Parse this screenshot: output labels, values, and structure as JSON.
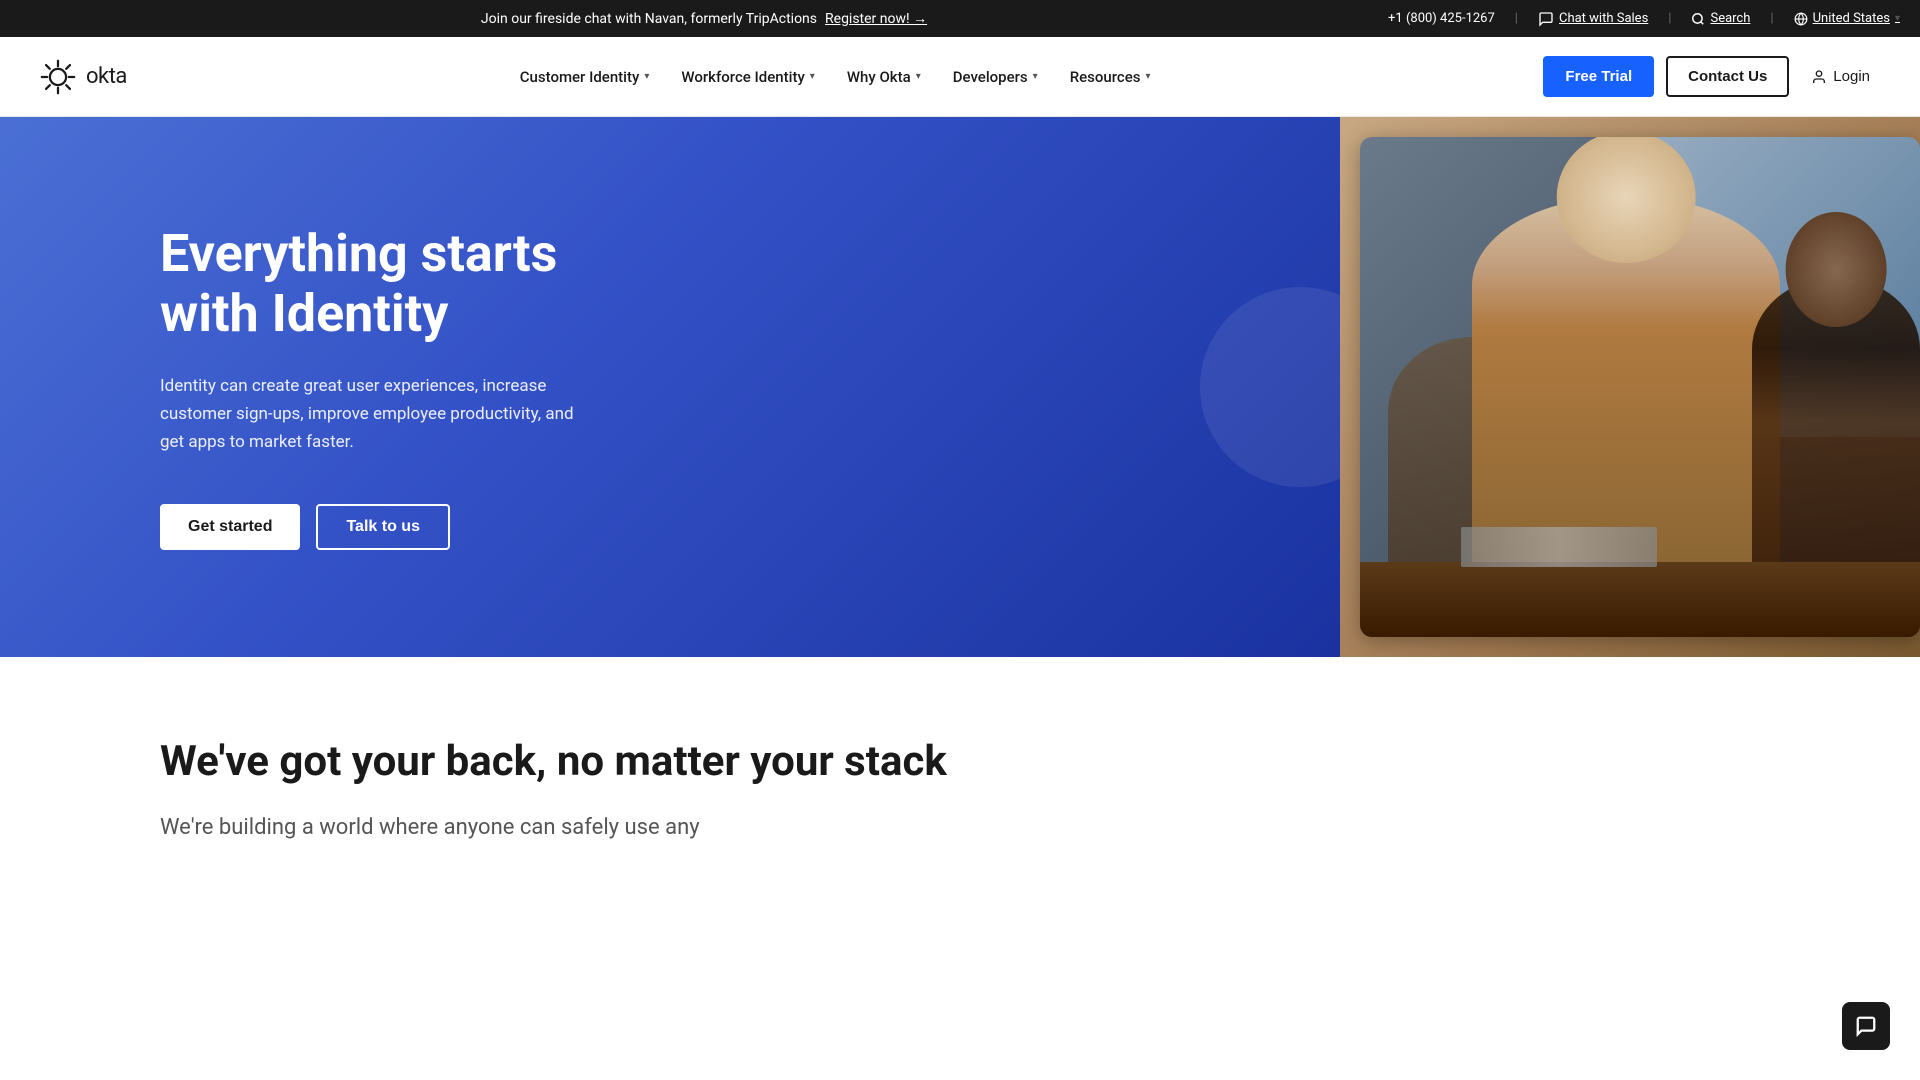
{
  "announcement": {
    "text": "Join our fireside chat with Navan, formerly TripActions",
    "cta_label": "Register now! →",
    "phone": "+1 (800) 425-1267",
    "chat_label": "Chat with Sales",
    "search_label": "Search",
    "region_label": "United States"
  },
  "nav": {
    "logo_text": "okta",
    "items": [
      {
        "label": "Customer Identity",
        "has_dropdown": true
      },
      {
        "label": "Workforce Identity",
        "has_dropdown": true
      },
      {
        "label": "Why Okta",
        "has_dropdown": true
      },
      {
        "label": "Developers",
        "has_dropdown": true
      },
      {
        "label": "Resources",
        "has_dropdown": true
      }
    ],
    "free_trial_label": "Free Trial",
    "contact_us_label": "Contact Us",
    "login_label": "Login"
  },
  "hero": {
    "heading": "Everything starts with Identity",
    "subtext": "Identity can create great user experiences, increase customer sign-ups, improve employee productivity, and get apps to market faster.",
    "get_started_label": "Get started",
    "talk_label": "Talk to us"
  },
  "stack_section": {
    "heading": "We've got your back, no matter your stack",
    "subtext": "We're building a world where anyone can safely use any"
  },
  "chat_widget": {
    "label": "Open chat"
  },
  "colors": {
    "brand_blue": "#1762ff",
    "hero_gradient_start": "#4a6fd4",
    "hero_gradient_end": "#1a32a0",
    "dark": "#1a1a1a",
    "text_muted": "#555555"
  }
}
